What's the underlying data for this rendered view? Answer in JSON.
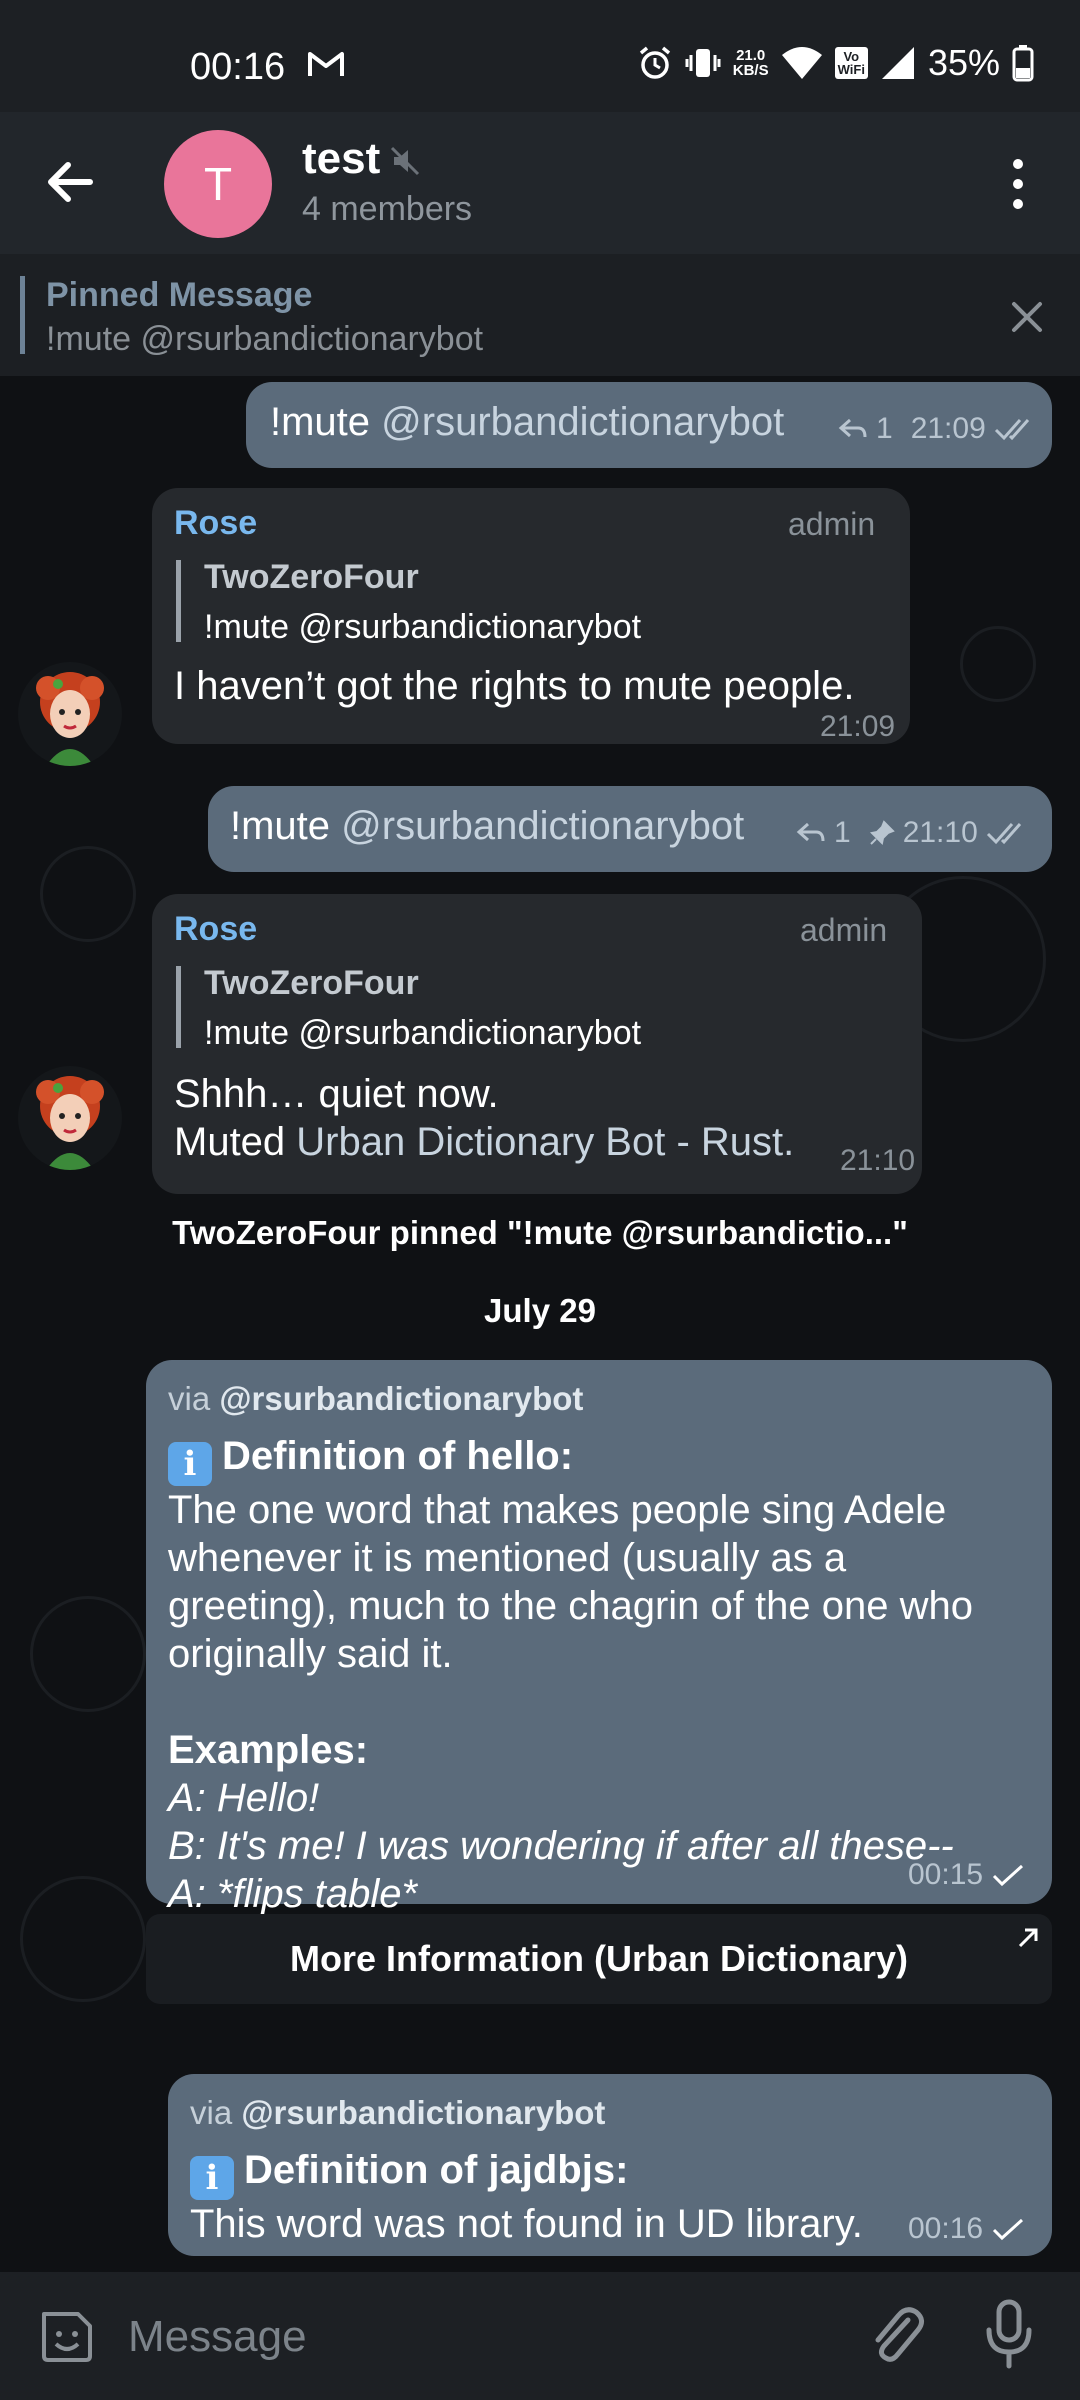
{
  "status_bar": {
    "time": "00:16",
    "net_speed_top": "21.0",
    "net_speed_bottom": "KB/S",
    "volte_top": "Vo",
    "volte_bottom": "WiFi",
    "battery": "35%"
  },
  "header": {
    "avatar_letter": "T",
    "title": "test",
    "subtitle": "4 members"
  },
  "pinned": {
    "title": "Pinned Message",
    "text": "!mute @rsurbandictionarybot"
  },
  "messages": [
    {
      "command": "!mute",
      "mention": "@rsurbandictionarybot",
      "replies": "1",
      "time": "21:09"
    },
    {
      "sender": "Rose",
      "role": "admin",
      "quote_name": "TwoZeroFour",
      "quote_text": "!mute @rsurbandictionarybot",
      "text": "I haven’t got the rights to mute people.",
      "time": "21:09"
    },
    {
      "command": "!mute",
      "mention": "@rsurbandictionarybot",
      "replies": "1",
      "time": "21:10"
    },
    {
      "sender": "Rose",
      "role": "admin",
      "quote_name": "TwoZeroFour",
      "quote_text": "!mute @rsurbandictionarybot",
      "line1": "Shhh… quiet now.",
      "line2_prefix": "Muted ",
      "line2_link": "Urban Dictionary Bot - Rust.",
      "time": "21:10"
    }
  ],
  "service_pinned": "TwoZeroFour pinned \"!mute @rsurbandictio...\"",
  "date_separator": "July 29",
  "inline1": {
    "via_prefix": "via ",
    "via_bot": "@rsurbandictionarybot",
    "info_glyph": "i",
    "heading": "Definition of hello:",
    "body_l1": "The one word that makes people sing Adele",
    "body_l2": "whenever it is mentioned (usually as a",
    "body_l3": "greeting), much to the chagrin of the one who",
    "body_l4": "originally said it.",
    "examples_label": "Examples:",
    "ex1": "A: Hello!",
    "ex2": "B: It's me! I was wondering if after all these--",
    "ex3": "A: *flips table*",
    "time": "00:15",
    "button": "More Information (Urban Dictionary)"
  },
  "inline2": {
    "via_prefix": "via ",
    "via_bot": "@rsurbandictionarybot",
    "info_glyph": "i",
    "heading": "Definition of jajdbjs:",
    "body": "This word was not found in UD library.",
    "time": "00:16"
  },
  "input": {
    "placeholder": "Message"
  },
  "colors": {
    "outgoing_bubble": "#5b6b7b",
    "incoming_bubble": "#26292d",
    "sender_name": "#79b8ee",
    "avatar": "#e9759a"
  }
}
